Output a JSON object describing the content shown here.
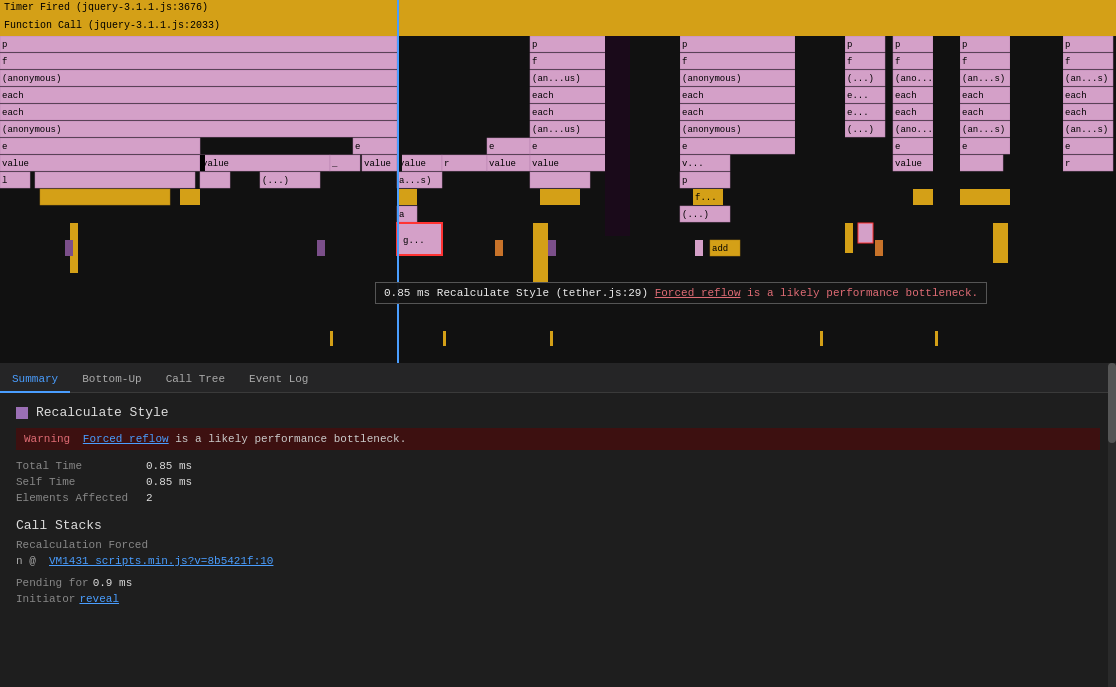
{
  "header": {
    "timer_fired": "Timer Fired (jquery-3.1.1.js:3676)",
    "function_call": "Function Call (jquery-3.1.1.js:2033)"
  },
  "tabs": [
    {
      "label": "Summary",
      "active": true
    },
    {
      "label": "Bottom-Up",
      "active": false
    },
    {
      "label": "Call Tree",
      "active": false
    },
    {
      "label": "Event Log",
      "active": false
    }
  ],
  "summary": {
    "title": "Recalculate Style",
    "warning_label": "Warning",
    "warning_link": "Forced reflow",
    "warning_text": " is a likely performance bottleneck.",
    "total_time_label": "Total Time",
    "total_time_value": "0.85 ms",
    "self_time_label": "Self Time",
    "self_time_value": "0.85 ms",
    "elements_label": "Elements Affected",
    "elements_value": "2"
  },
  "call_stacks": {
    "heading": "Call Stacks",
    "sublabel": "Recalculation Forced",
    "stack_text": "n @ ",
    "stack_link": "VM1431 scripts.min.js?v=8b5421f:10",
    "pending_label": "Pending for",
    "pending_value": "0.9 ms",
    "initiator_label": "Initiator",
    "initiator_link": "reveal"
  },
  "tooltip": {
    "time": "0.85 ms",
    "event": "Recalculate Style (tether.js:29)",
    "forced_reflow": "Forced reflow",
    "bottleneck": " is a likely performance bottleneck."
  },
  "colors": {
    "pink": "#d4a0c8",
    "yellow": "#d4a017",
    "dark_bg": "#111111",
    "blue_line": "#4a9eff",
    "warning_bg": "#3d1010",
    "accent_purple": "#9b6fb5"
  }
}
